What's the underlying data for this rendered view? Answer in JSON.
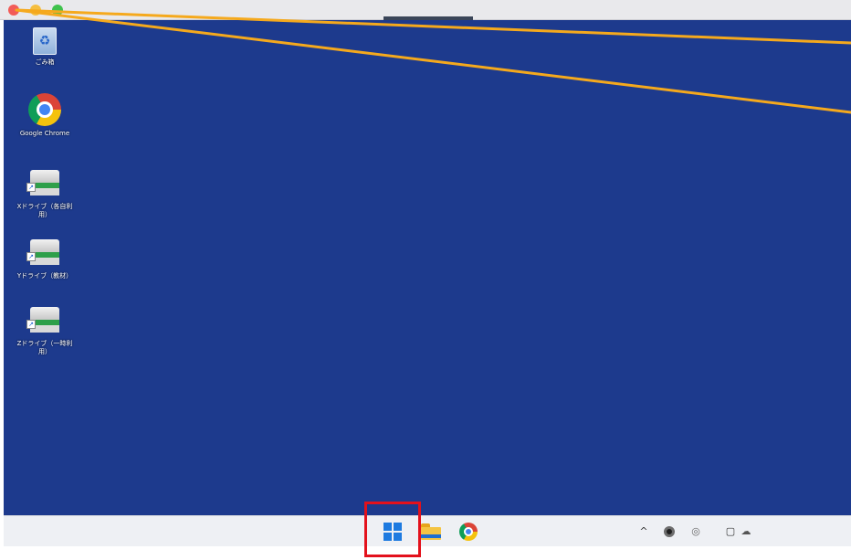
{
  "window": {
    "controls": [
      "close",
      "minimize",
      "zoom"
    ]
  },
  "desktop": {
    "background_color": "#1d3a8d",
    "icons": [
      {
        "icon": "recycle-bin-icon",
        "label": "ごみ箱"
      },
      {
        "icon": "chrome-icon",
        "label": "Google Chrome"
      },
      {
        "icon": "network-drive-icon",
        "label": "Xドライブ（各自利\n用）"
      },
      {
        "icon": "network-drive-icon",
        "label": "Yドライブ（教材）"
      },
      {
        "icon": "network-drive-icon",
        "label": "Zドライブ（一時利\n用）"
      }
    ]
  },
  "taskbar": {
    "apps": [
      {
        "icon": "windows-start-icon",
        "highlighted": true
      },
      {
        "icon": "file-explorer-icon"
      },
      {
        "icon": "chrome-icon"
      }
    ],
    "tray": {
      "chevron": "^",
      "sync": "◎",
      "notification": "▢",
      "cloud": "☁"
    }
  },
  "annotation": {
    "highlight_color": "#e3111c",
    "callout_color": "#f5a91d"
  }
}
